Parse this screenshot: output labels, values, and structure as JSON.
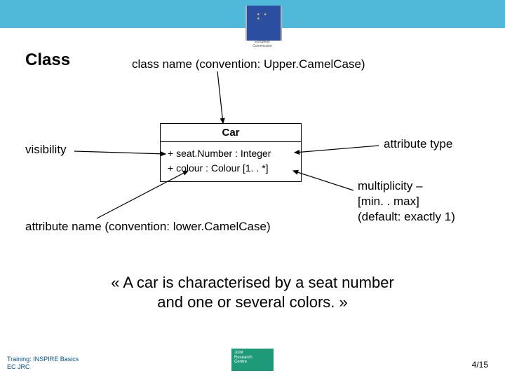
{
  "header": {
    "logo_caption_line1": "European",
    "logo_caption_line2": "Commission"
  },
  "title": "Class",
  "labels": {
    "classname": "class name (convention: Upper.CamelCase)",
    "visibility": "visibility",
    "attrtype": "attribute type",
    "mult_l1": "multiplicity –",
    "mult_l2": "[min. . max]",
    "mult_l3": "(default: exactly 1)",
    "attrname": "attribute name (convention: lower.CamelCase)"
  },
  "uml": {
    "name": "Car",
    "attr1": "+ seat.Number : Integer",
    "attr2": "+ colour : Colour [1. . *]"
  },
  "quote_l1": "« A car is characterised by a seat number",
  "quote_l2": "and one or several colors. »",
  "footer": {
    "training_l1": "Training: INSPIRE Basics",
    "training_l2": "EC JRC",
    "badge_l1": "Joint",
    "badge_l2": "Research",
    "badge_l3": "Centre"
  },
  "page": "4/15"
}
